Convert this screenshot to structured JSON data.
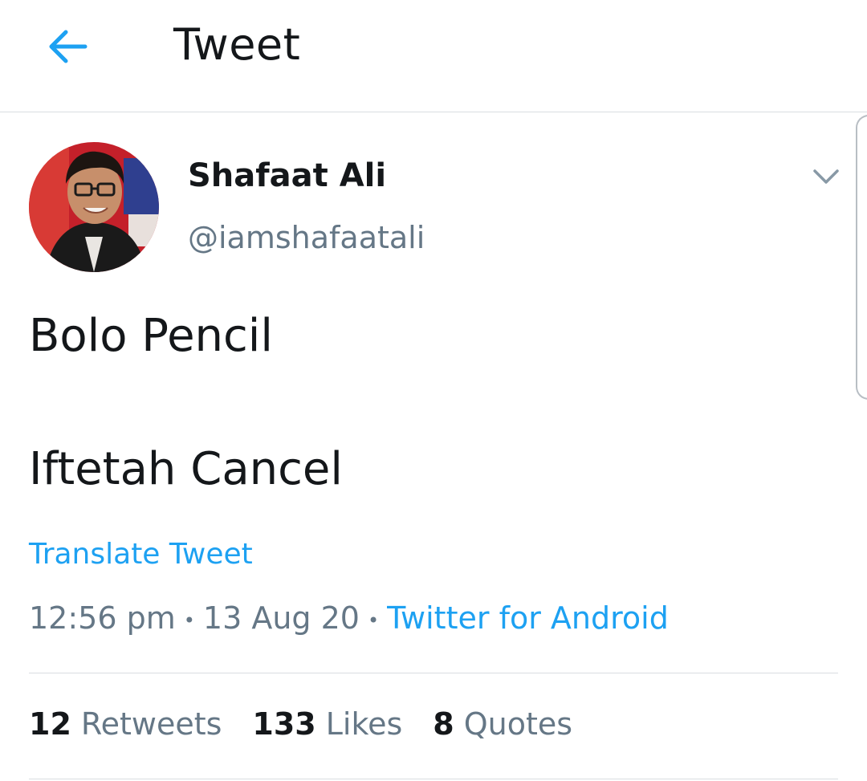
{
  "header": {
    "title": "Tweet",
    "back_icon": "arrow-left-icon"
  },
  "colors": {
    "accent": "#1da1f2",
    "text": "#14171a",
    "secondary": "#657786",
    "divider": "#d9dde1"
  },
  "tweet": {
    "author": {
      "name": "Shafaat Ali",
      "handle": "@iamshafaatali"
    },
    "menu_icon": "chevron-down-icon",
    "lines": [
      "Bolo Pencil",
      "Iftetah Cancel"
    ],
    "translate_label": "Translate Tweet",
    "time": "12:56 pm",
    "date": "13 Aug 20",
    "separator": "•",
    "source": "Twitter for Android",
    "stats": [
      {
        "count": "12",
        "label": "Retweets"
      },
      {
        "count": "133",
        "label": "Likes"
      },
      {
        "count": "8",
        "label": "Quotes"
      }
    ]
  }
}
